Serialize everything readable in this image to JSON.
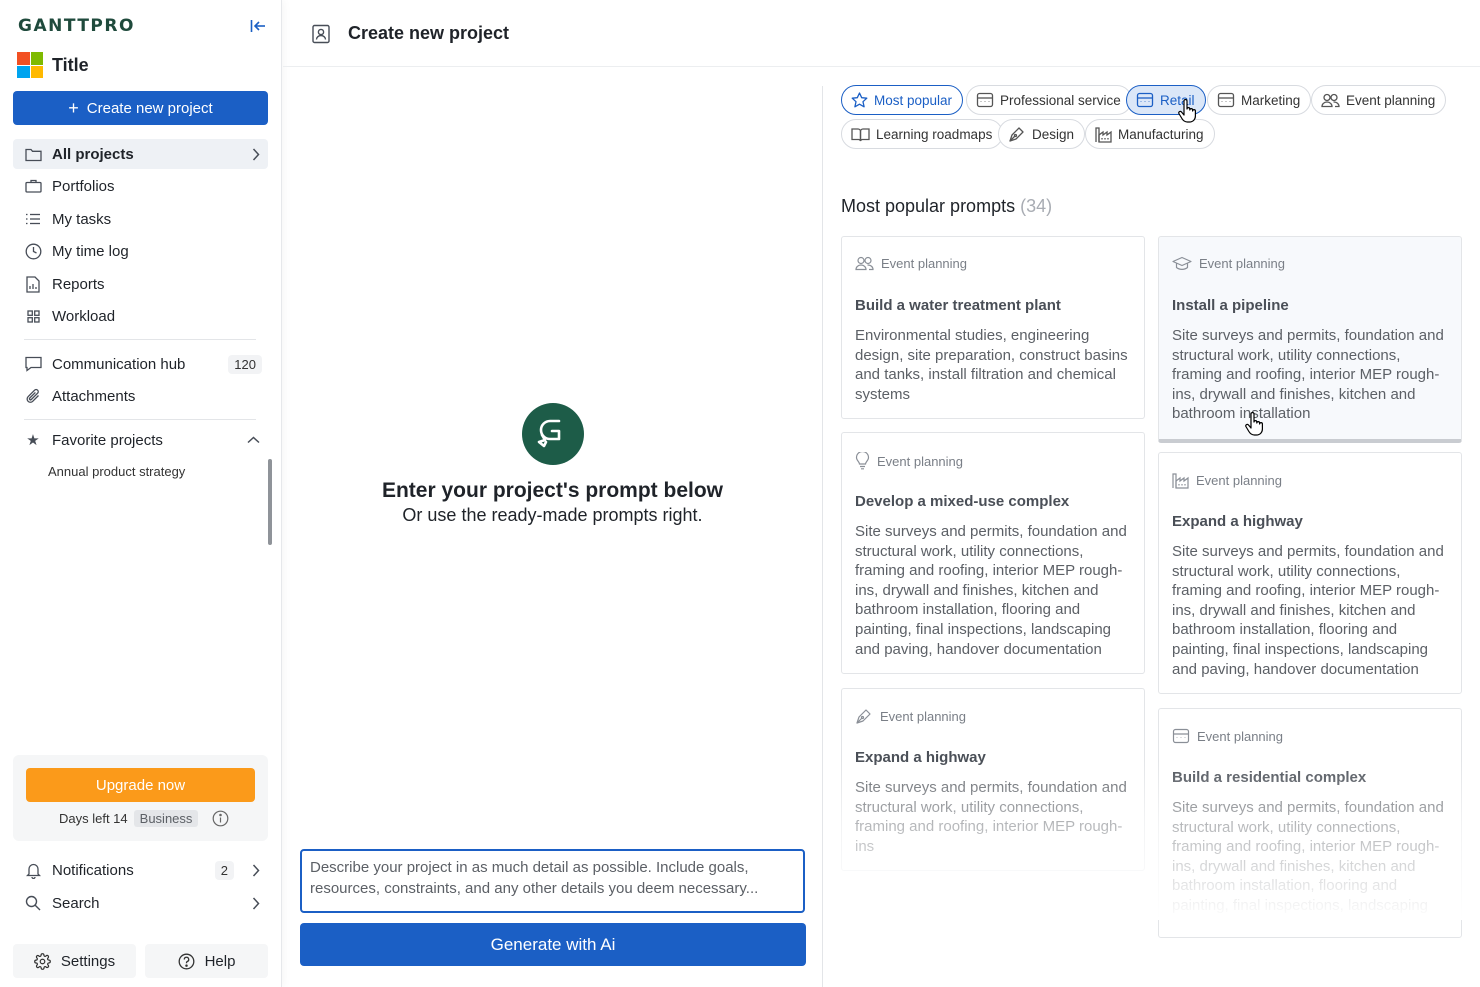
{
  "sidebar": {
    "logo": "GANTTPRO",
    "workspace_title": "Title",
    "create_label": "Create new project",
    "nav": [
      {
        "label": "All projects",
        "icon": "folder-icon"
      },
      {
        "label": "Portfolios",
        "icon": "briefcase-icon"
      },
      {
        "label": "My tasks",
        "icon": "list-icon"
      },
      {
        "label": "My time log",
        "icon": "clock-icon"
      },
      {
        "label": "Reports",
        "icon": "report-icon"
      },
      {
        "label": "Workload",
        "icon": "grid-icon"
      }
    ],
    "communication_hub": {
      "label": "Communication hub",
      "count": "120"
    },
    "attachments": "Attachments",
    "favorites": {
      "label": "Favorite projects",
      "items": [
        "Annual product strategy"
      ]
    },
    "upgrade": {
      "button": "Upgrade now",
      "days_left": "Days left 14",
      "plan": "Business"
    },
    "notifications": {
      "label": "Notifications",
      "count": "2"
    },
    "search": "Search",
    "settings": "Settings",
    "help": "Help"
  },
  "header": {
    "title": "Create new project"
  },
  "center": {
    "title": "Enter your project's prompt below",
    "subtitle": "Or use the ready-made prompts right.",
    "input_placeholder": "Describe your project in as much detail as possible. Include goals, resources, constraints, and any other details you deem necessary...",
    "generate_label": "Generate with Ai"
  },
  "filters": [
    {
      "label": "Most popular",
      "icon": "star-icon",
      "state": "selected"
    },
    {
      "label": "Professional service",
      "icon": "store-icon",
      "state": "default"
    },
    {
      "label": "Retail",
      "icon": "store-icon",
      "state": "hover"
    },
    {
      "label": "Marketing",
      "icon": "store-icon",
      "state": "default"
    },
    {
      "label": "Event planning",
      "icon": "users-icon",
      "state": "default"
    },
    {
      "label": "Learning roadmaps",
      "icon": "book-icon",
      "state": "default"
    },
    {
      "label": "Design",
      "icon": "pen-icon",
      "state": "default"
    },
    {
      "label": "Manufacturing",
      "icon": "factory-icon",
      "state": "default"
    }
  ],
  "prompts_section": {
    "title": "Most popular prompts",
    "count": "(34)"
  },
  "cards": [
    {
      "category": "Event planning",
      "icon": "users-icon",
      "title": "Build a water treatment plant",
      "description": "Environmental studies, engineering design, site preparation, construct basins and tanks, install filtration and chemical systems"
    },
    {
      "category": "Event planning",
      "icon": "graduation-cap-icon",
      "title": "Install a pipeline",
      "description": "Site surveys and permits, foundation and structural work, utility connections, framing and roofing, interior MEP rough-ins, drywall and finishes, kitchen and bathroom installation"
    },
    {
      "category": "Event planning",
      "icon": "lightbulb-icon",
      "title": "Develop a mixed-use complex",
      "description": "Site surveys and permits, foundation and structural work, utility connections, framing and roofing, interior MEP rough-ins, drywall and finishes, kitchen and bathroom installation, flooring and painting, final inspections, landscaping and paving, handover documentation"
    },
    {
      "category": "Event planning",
      "icon": "factory-icon",
      "title": "Expand a highway",
      "description": "Site surveys and permits, foundation and structural work, utility connections, framing and roofing, interior MEP rough-ins, drywall and finishes, kitchen and bathroom installation, flooring and painting, final inspections, landscaping and paving, handover documentation"
    },
    {
      "category": "Event planning",
      "icon": "pen-icon",
      "title": "Expand a highway",
      "description": "Site surveys and permits, foundation and structural work, utility connections, framing and roofing, interior MEP rough-ins"
    },
    {
      "category": "Event planning",
      "icon": "store-icon",
      "title": "Build a residential complex",
      "description": "Site surveys and permits, foundation and structural work, utility connections, framing and roofing, interior MEP rough-ins, drywall and finishes, kitchen and bathroom installation, flooring and painting, final inspections, landscaping"
    }
  ],
  "colors": {
    "primary": "#1b5fc5",
    "upgrade": "#fb9a1a",
    "ai_logo": "#1d5c48",
    "favorite_star": "#f2a228"
  }
}
